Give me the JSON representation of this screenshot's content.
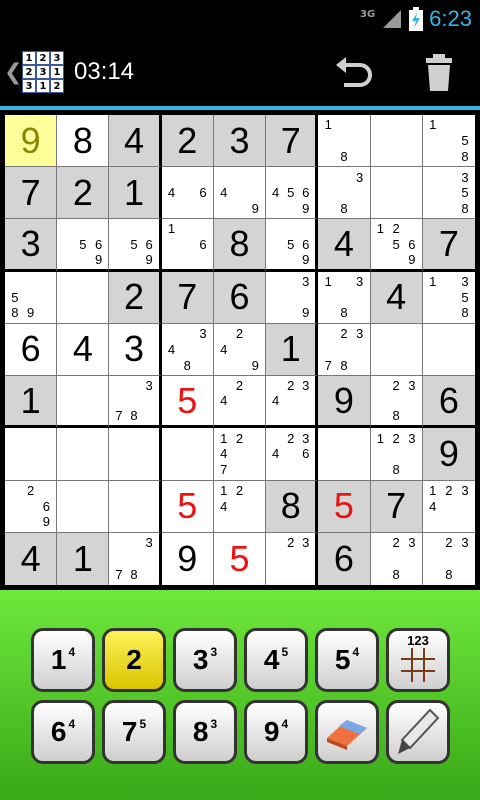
{
  "status_bar": {
    "network": "3G",
    "time": "6:23",
    "accent_color": "#33b5e5"
  },
  "action_bar": {
    "back_icon": "chevron-left-icon",
    "app_icon_digits": [
      "1",
      "2",
      "3",
      "2",
      "3",
      "1",
      "3",
      "1",
      "2"
    ],
    "timer": "03:14",
    "undo_icon": "undo-icon",
    "trash_icon": "trash-icon"
  },
  "board": {
    "selected_cell": [
      0,
      0
    ],
    "cells": [
      [
        {
          "v": "9",
          "t": "sel"
        },
        {
          "v": "8",
          "t": "given"
        },
        {
          "v": "4",
          "t": "given",
          "g": true
        },
        {
          "v": "2",
          "t": "given",
          "g": true
        },
        {
          "v": "3",
          "t": "given",
          "g": true
        },
        {
          "v": "7",
          "t": "given",
          "g": true
        },
        {
          "n": [
            "1",
            "",
            "",
            "",
            "",
            "",
            "",
            "8",
            ""
          ]
        },
        {
          "n": [
            "",
            "",
            "",
            "",
            "",
            "",
            "",
            "",
            ""
          ]
        },
        {
          "n": [
            "1",
            "",
            "",
            "",
            "",
            "5",
            "",
            "",
            "8"
          ]
        }
      ],
      [
        {
          "v": "7",
          "t": "given",
          "g": true
        },
        {
          "v": "2",
          "t": "given",
          "g": true
        },
        {
          "v": "1",
          "t": "given",
          "g": true
        },
        {
          "n": [
            "",
            "",
            "",
            "4",
            "",
            "6",
            "",
            "",
            ""
          ]
        },
        {
          "n": [
            "",
            "",
            "",
            "4",
            "",
            "",
            "",
            "",
            "9"
          ]
        },
        {
          "n": [
            "",
            "",
            "",
            "4",
            "5",
            "6",
            "",
            "",
            "9"
          ]
        },
        {
          "n": [
            "",
            "",
            "3",
            "",
            "",
            "",
            "",
            "8",
            ""
          ]
        },
        {
          "n": [
            "",
            "",
            "",
            "",
            "",
            "",
            "",
            "",
            ""
          ]
        },
        {
          "n": [
            "",
            "",
            "3",
            "",
            "",
            "5",
            "",
            "",
            "8"
          ]
        }
      ],
      [
        {
          "v": "3",
          "t": "given",
          "g": true
        },
        {
          "n": [
            "",
            "",
            "",
            "",
            "5",
            "6",
            "",
            "",
            "9"
          ]
        },
        {
          "n": [
            "",
            "",
            "",
            "",
            "5",
            "6",
            "",
            "",
            "9"
          ]
        },
        {
          "n": [
            "1",
            "",
            "",
            "",
            "",
            "6",
            "",
            "",
            ""
          ]
        },
        {
          "v": "8",
          "t": "given",
          "g": true
        },
        {
          "n": [
            "",
            "",
            "",
            "",
            "5",
            "6",
            "",
            "",
            "9"
          ]
        },
        {
          "v": "4",
          "t": "given",
          "g": true
        },
        {
          "n": [
            "1",
            "2",
            "",
            "",
            "5",
            "6",
            "",
            "",
            "9"
          ]
        },
        {
          "v": "7",
          "t": "given",
          "g": true
        }
      ],
      [
        {
          "n": [
            "",
            "",
            "",
            "5",
            "",
            "",
            "8",
            "9",
            ""
          ]
        },
        {
          "n": [
            "",
            "",
            "",
            "",
            "",
            "",
            "",
            "",
            ""
          ]
        },
        {
          "v": "2",
          "t": "given",
          "g": true
        },
        {
          "v": "7",
          "t": "given",
          "g": true
        },
        {
          "v": "6",
          "t": "given",
          "g": true
        },
        {
          "n": [
            "",
            "",
            "3",
            "",
            "",
            "",
            "",
            "",
            "9"
          ]
        },
        {
          "n": [
            "1",
            "",
            "3",
            "",
            "",
            "",
            "",
            "8",
            ""
          ]
        },
        {
          "v": "4",
          "t": "given",
          "g": true
        },
        {
          "n": [
            "1",
            "",
            "3",
            "",
            "",
            "5",
            "",
            "",
            "8"
          ]
        }
      ],
      [
        {
          "v": "6",
          "t": "given"
        },
        {
          "v": "4",
          "t": "given"
        },
        {
          "v": "3",
          "t": "given"
        },
        {
          "n": [
            "",
            "",
            "3",
            "4",
            "",
            "",
            "",
            "8",
            ""
          ]
        },
        {
          "n": [
            "",
            "2",
            "",
            "4",
            "",
            "",
            "",
            "",
            "9"
          ]
        },
        {
          "v": "1",
          "t": "given",
          "g": true
        },
        {
          "n": [
            "",
            "2",
            "3",
            "",
            "",
            "",
            "7",
            "8",
            ""
          ]
        },
        {
          "n": [
            "",
            "",
            "",
            "",
            "",
            "",
            "",
            "",
            ""
          ]
        },
        {
          "n": [
            "",
            "",
            "",
            "",
            "",
            "",
            "",
            "",
            ""
          ]
        }
      ],
      [
        {
          "v": "1",
          "t": "given",
          "g": true
        },
        {
          "n": [
            "",
            "",
            "",
            "",
            "",
            "",
            "",
            "",
            ""
          ]
        },
        {
          "n": [
            "",
            "",
            "3",
            "",
            "",
            "",
            "7",
            "8",
            ""
          ]
        },
        {
          "v": "5",
          "t": "user"
        },
        {
          "n": [
            "",
            "2",
            "",
            "4",
            "",
            "",
            "",
            "",
            ""
          ]
        },
        {
          "n": [
            "",
            "2",
            "3",
            "4",
            "",
            "",
            "",
            "",
            ""
          ]
        },
        {
          "v": "9",
          "t": "given",
          "g": true
        },
        {
          "n": [
            "",
            "2",
            "3",
            "",
            "",
            "",
            "",
            "8",
            ""
          ]
        },
        {
          "v": "6",
          "t": "given",
          "g": true
        }
      ],
      [
        {
          "n": [
            "",
            "",
            "",
            "",
            "",
            "",
            "",
            "",
            ""
          ]
        },
        {
          "n": [
            "",
            "",
            "",
            "",
            "",
            "",
            "",
            "",
            ""
          ]
        },
        {
          "n": [
            "",
            "",
            "",
            "",
            "",
            "",
            "",
            "",
            ""
          ]
        },
        {
          "n": [
            "",
            "",
            "",
            "",
            "",
            "",
            "",
            "",
            ""
          ]
        },
        {
          "n": [
            "1",
            "2",
            "",
            "4",
            "",
            "",
            "7",
            "",
            ""
          ]
        },
        {
          "n": [
            "",
            "2",
            "3",
            "4",
            "",
            "6",
            "",
            "",
            ""
          ]
        },
        {
          "n": [
            "",
            "",
            "",
            "",
            "",
            "",
            "",
            "",
            ""
          ]
        },
        {
          "n": [
            "1",
            "2",
            "3",
            "",
            "",
            "",
            "",
            "8",
            ""
          ]
        },
        {
          "v": "9",
          "t": "given",
          "g": true
        }
      ],
      [
        {
          "n": [
            "",
            "2",
            "",
            "",
            "",
            "6",
            "",
            "",
            "9"
          ]
        },
        {
          "n": [
            "",
            "",
            "",
            "",
            "",
            "",
            "",
            "",
            ""
          ]
        },
        {
          "n": [
            "",
            "",
            "",
            "",
            "",
            "",
            "",
            "",
            ""
          ]
        },
        {
          "v": "5",
          "t": "user"
        },
        {
          "n": [
            "1",
            "2",
            "",
            "4",
            "",
            "",
            "",
            "",
            ""
          ]
        },
        {
          "v": "8",
          "t": "given",
          "g": true
        },
        {
          "v": "5",
          "t": "user",
          "g": true
        },
        {
          "v": "7",
          "t": "given",
          "g": true
        },
        {
          "n": [
            "1",
            "2",
            "3",
            "4",
            "",
            "",
            "",
            "",
            ""
          ]
        }
      ],
      [
        {
          "v": "4",
          "t": "given",
          "g": true
        },
        {
          "v": "1",
          "t": "given",
          "g": true
        },
        {
          "n": [
            "",
            "",
            "3",
            "",
            "",
            "",
            "7",
            "8",
            ""
          ]
        },
        {
          "v": "9",
          "t": "given"
        },
        {
          "v": "5",
          "t": "user"
        },
        {
          "n": [
            "",
            "2",
            "3",
            "",
            "",
            "",
            "",
            "",
            ""
          ]
        },
        {
          "v": "6",
          "t": "given",
          "g": true
        },
        {
          "n": [
            "",
            "2",
            "3",
            "",
            "",
            "",
            "",
            "8",
            ""
          ]
        },
        {
          "n": [
            "",
            "2",
            "3",
            "",
            "",
            "",
            "",
            "8",
            ""
          ]
        }
      ]
    ]
  },
  "keypad": {
    "keys": [
      {
        "digit": "1",
        "count": "4",
        "active": false
      },
      {
        "digit": "2",
        "count": "",
        "active": true
      },
      {
        "digit": "3",
        "count": "3",
        "active": false
      },
      {
        "digit": "4",
        "count": "5",
        "active": false
      },
      {
        "digit": "5",
        "count": "4",
        "active": false
      },
      {
        "digit": "6",
        "count": "4",
        "active": false
      },
      {
        "digit": "7",
        "count": "5",
        "active": false
      },
      {
        "digit": "8",
        "count": "3",
        "active": false
      },
      {
        "digit": "9",
        "count": "4",
        "active": false
      }
    ],
    "notes_key_label": "123",
    "eraser_icon": "eraser-icon",
    "pencil_icon": "pencil-icon"
  }
}
